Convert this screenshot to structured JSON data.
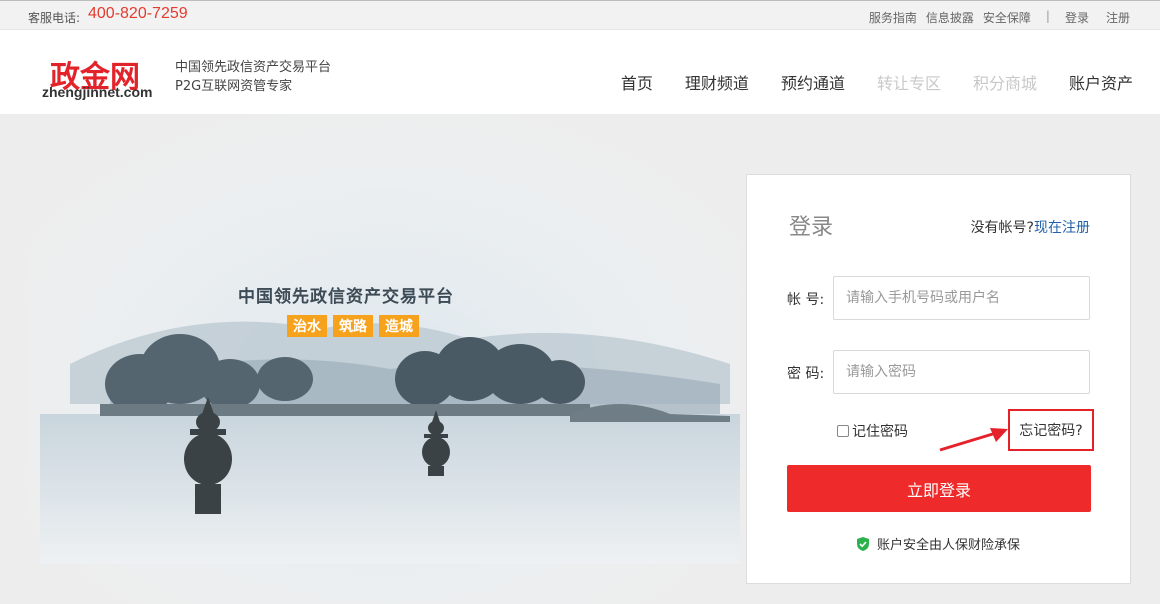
{
  "topbar": {
    "hotline_label": "客服电话:",
    "hotline_number": "400-820-7259",
    "links": [
      "服务指南",
      "信息披露",
      "安全保障"
    ],
    "separator": "|",
    "login": "登录",
    "register": "注册"
  },
  "header": {
    "logo_cn": "政金网",
    "logo_en": "zhengjinnet.com",
    "tagline_line1": "中国领先政信资产交易平台",
    "tagline_line2": "P2G互联网资管专家",
    "nav": [
      {
        "label": "首页",
        "enabled": true
      },
      {
        "label": "理财频道",
        "enabled": true
      },
      {
        "label": "预约通道",
        "enabled": true
      },
      {
        "label": "转让专区",
        "enabled": false
      },
      {
        "label": "积分商城",
        "enabled": false
      },
      {
        "label": "账户资产",
        "enabled": true
      }
    ]
  },
  "banner": {
    "title": "中国领先政信资产交易平台",
    "tags": [
      "治水",
      "筑路",
      "造城"
    ]
  },
  "login": {
    "title": "登录",
    "no_account": "没有帐号?",
    "register_link": "现在注册",
    "account_label": "帐 号:",
    "account_placeholder": "请输入手机号码或用户名",
    "password_label": "密 码:",
    "password_placeholder": "请输入密码",
    "remember_label": "记住密码",
    "forgot_label": "忘记密码?",
    "submit_label": "立即登录",
    "safety_note": "账户安全由人保财险承保"
  },
  "colors": {
    "accent_red": "#ee2a2a",
    "link_blue": "#2362a7",
    "tag_orange": "#f6a21d",
    "safety_green": "#2bb24c"
  }
}
